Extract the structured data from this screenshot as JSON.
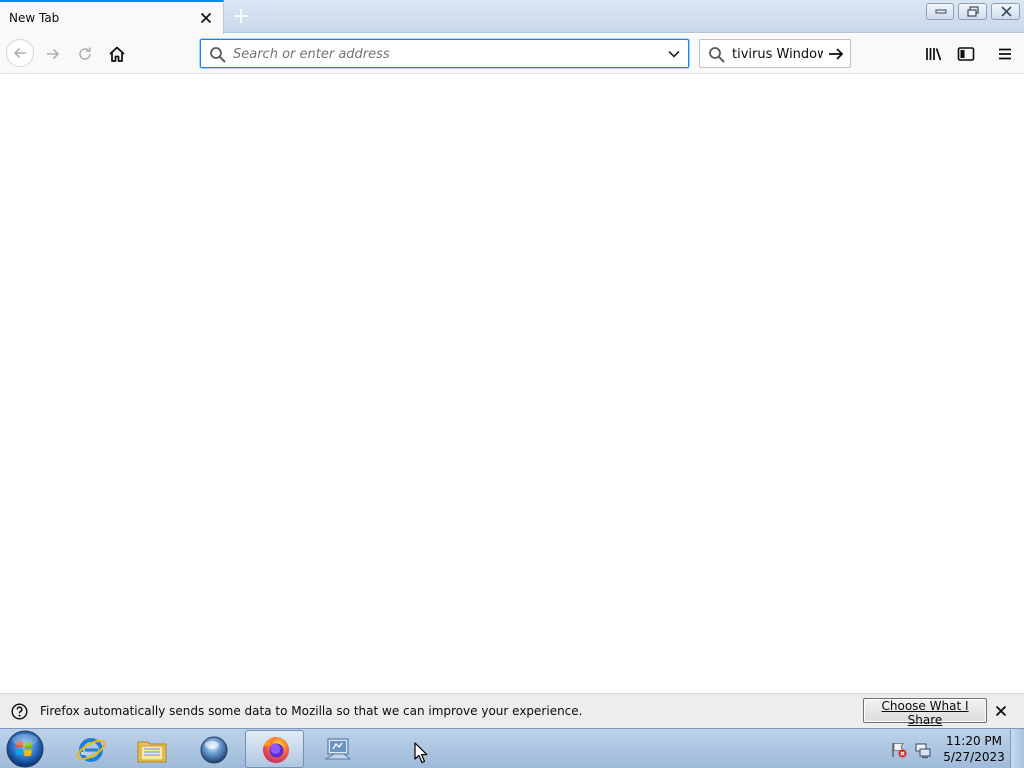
{
  "browser": {
    "tab": {
      "title": "New Tab"
    },
    "urlbar": {
      "placeholder": "Search or enter address",
      "value": ""
    },
    "searchbar": {
      "text": "tivirus Window"
    },
    "accent_color": "#0a84ff"
  },
  "notification": {
    "message": "Firefox automatically sends some data to Mozilla so that we can improve your experience.",
    "button_label": "Choose What I Share"
  },
  "taskbar": {
    "clock_time": "11:20 PM",
    "clock_date": "5/27/2023",
    "apps": [
      "internet-explorer-icon",
      "windows-explorer-icon",
      "media-player-icon",
      "firefox-icon",
      "network-app-icon"
    ]
  }
}
